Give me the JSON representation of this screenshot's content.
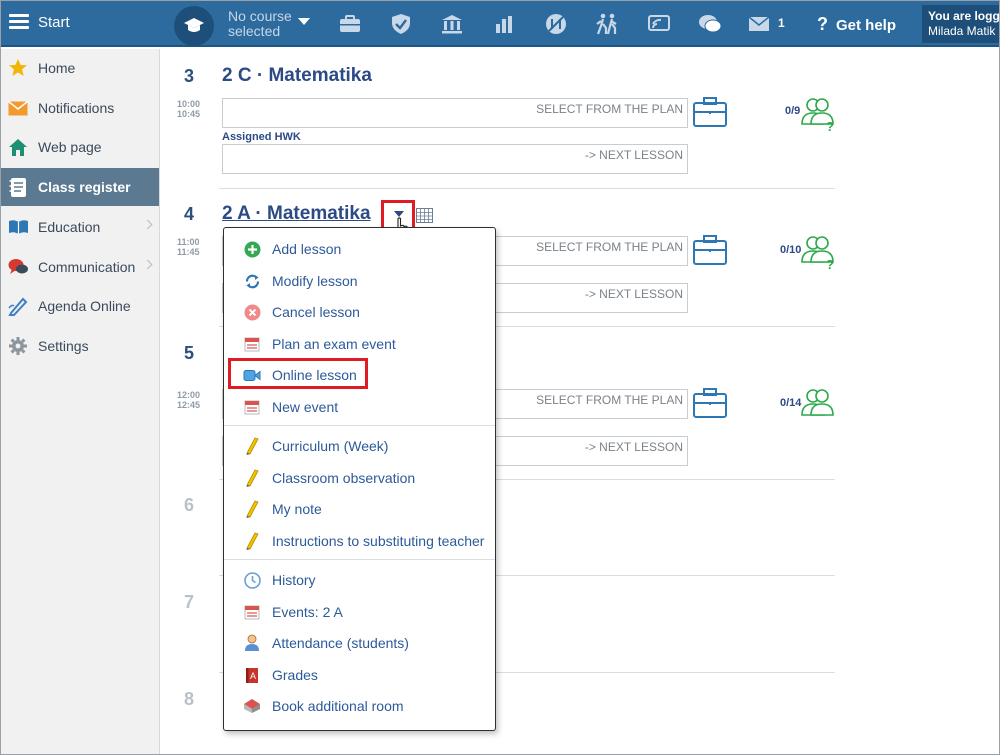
{
  "topbar": {
    "start_label": "Start",
    "course_label_line1": "No course",
    "course_label_line2": "selected",
    "messages_count": "1",
    "help_label": "Get help",
    "user_line1": "You are logged",
    "user_line2": "Milada Matik"
  },
  "sidebar": {
    "items": [
      {
        "label": "Home",
        "icon": "star-icon"
      },
      {
        "label": "Notifications",
        "icon": "envelope-icon"
      },
      {
        "label": "Web page",
        "icon": "house-icon"
      },
      {
        "label": "Class register",
        "icon": "notebook-icon"
      },
      {
        "label": "Education",
        "icon": "book-icon"
      },
      {
        "label": "Communication",
        "icon": "speech-bubbles-icon"
      },
      {
        "label": "Agenda Online",
        "icon": "pen-icon"
      },
      {
        "label": "Settings",
        "icon": "gear-icon"
      }
    ]
  },
  "lessons": [
    {
      "number": "3",
      "title": "2 C · Matematika",
      "time_start": "10:00",
      "time_end": "10:45",
      "plan_placeholder": "SELECT FROM THE PLAN",
      "hwk_label": "Assigned HWK",
      "next_placeholder": "-> NEXT LESSON",
      "count": "0/9"
    },
    {
      "number": "4",
      "title": "2 A · Matematika",
      "time_start": "11:00",
      "time_end": "11:45",
      "plan_placeholder": "SELECT FROM THE PLAN",
      "next_placeholder": "-> NEXT LESSON",
      "count": "0/10"
    },
    {
      "number": "5",
      "time_start": "12:00",
      "time_end": "12:45",
      "plan_placeholder": "SELECT FROM THE PLAN",
      "next_placeholder": "-> NEXT LESSON",
      "count": "0/14"
    },
    {
      "number": "6"
    },
    {
      "number": "7"
    },
    {
      "number": "8"
    }
  ],
  "menu": {
    "items": [
      {
        "label": "Add lesson",
        "icon": "plus-circle-icon"
      },
      {
        "label": "Modify lesson",
        "icon": "refresh-icon"
      },
      {
        "label": "Cancel lesson",
        "icon": "cancel-circle-icon"
      },
      {
        "label": "Plan an exam event",
        "icon": "calendar-event-icon"
      },
      {
        "label": "Online lesson",
        "icon": "video-camera-icon"
      },
      {
        "label": "New event",
        "icon": "calendar-event-icon"
      },
      {
        "label": "Curriculum (Week)",
        "icon": "pencil-icon"
      },
      {
        "label": "Classroom observation",
        "icon": "pencil-icon"
      },
      {
        "label": "My note",
        "icon": "pencil-icon"
      },
      {
        "label": "Instructions to substituting teacher",
        "icon": "pencil-icon"
      },
      {
        "label": "History",
        "icon": "clock-icon"
      },
      {
        "label": "Events: 2 A",
        "icon": "calendar-event-icon"
      },
      {
        "label": "Attendance (students)",
        "icon": "student-icon"
      },
      {
        "label": "Grades",
        "icon": "grades-book-icon"
      },
      {
        "label": "Book additional room",
        "icon": "room-icon"
      }
    ]
  },
  "colors": {
    "topbar": "#2d6a9e",
    "title": "#2c4a86",
    "sidebar_active": "#5b7a91",
    "highlight_red": "#e01b24",
    "people_green": "#2da84a"
  }
}
